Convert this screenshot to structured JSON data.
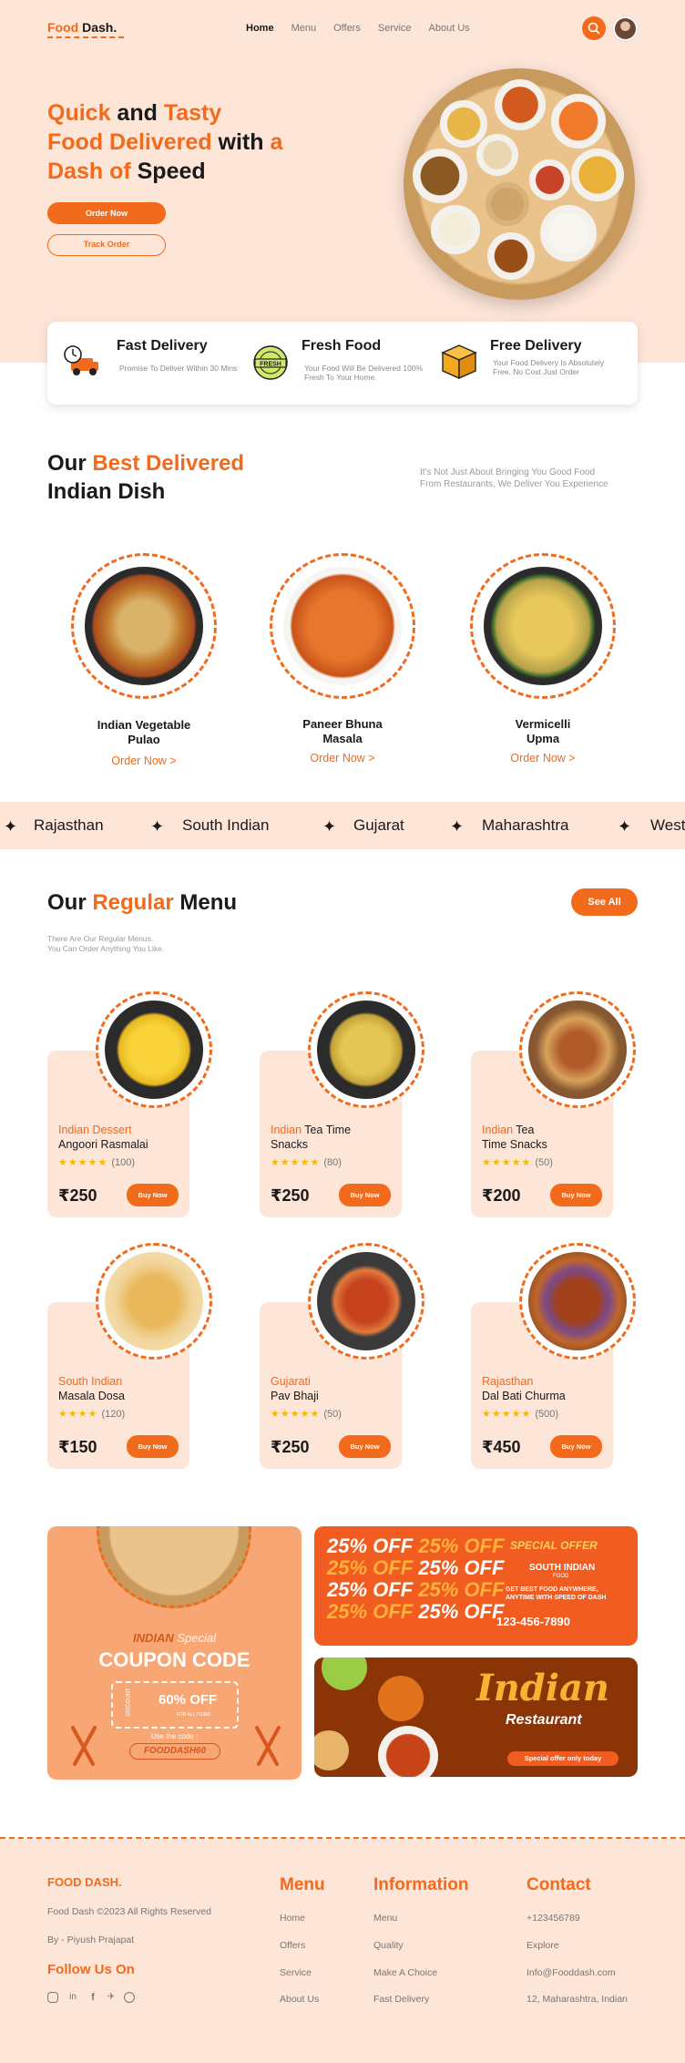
{
  "header": {
    "logo_part1": "Food",
    "logo_part2": "Dash.",
    "nav": [
      "Home",
      "Menu",
      "Offers",
      "Service",
      "About Us"
    ]
  },
  "hero": {
    "title_segments": [
      {
        "text": "Quick",
        "accent": true
      },
      {
        "text": " and ",
        "accent": false
      },
      {
        "text": "Tasty",
        "accent": true
      },
      {
        "text": "Food Delivered",
        "accent": true
      },
      {
        "text": " with ",
        "accent": false
      },
      {
        "text": "a",
        "accent": true
      },
      {
        "text": "Dash of",
        "accent": true
      },
      {
        "text": " Speed",
        "accent": false
      }
    ],
    "primary_button": "Order Now",
    "secondary_button": "Track Order"
  },
  "features": [
    {
      "title": "Fast Delivery",
      "subtitle": "Promise To Deliver Within 30 Mins",
      "icon": "delivery-truck-icon"
    },
    {
      "title": "Fresh Food",
      "subtitle": "Your Food Will Be Delivered 100% Fresh To Your Home.",
      "icon": "fresh-badge-icon",
      "badge": "FRESH"
    },
    {
      "title": "Free Delivery",
      "subtitle": "Your Food Delivery Is Absolutely Free. No Cost Just Order",
      "icon": "box-icon"
    }
  ],
  "best": {
    "title_our": "Our ",
    "title_accent": "Best Delivered",
    "title_line2": "Indian Dish",
    "subtitle_line1": "It's Not Just About Bringing You Good Food",
    "subtitle_line2": "From Restaurants, We Deliver You Experience",
    "dishes": [
      {
        "name_line1": "Indian Vegetable",
        "name_line2": "Pulao",
        "link": "Order Now >"
      },
      {
        "name_line1": "Paneer Bhuna",
        "name_line2": "Masala",
        "link": "Order Now >"
      },
      {
        "name_line1": "Vermicelli",
        "name_line2": "Upma",
        "link": "Order Now >"
      }
    ]
  },
  "regions": [
    "Rajasthan",
    "South Indian",
    "Gujarat",
    "Maharashtra",
    "West"
  ],
  "menu": {
    "title_our": "Our ",
    "title_accent": "Regular",
    "title_rest": " Menu",
    "see_all": "See All",
    "subtitle_line1": "There Are Our Regular Menus.",
    "subtitle_line2": "You Can Order Anything You Like.",
    "items": [
      {
        "cat_accent": "Indian Dessert",
        "cat_rest": "",
        "name": "Angoori Rasmalai",
        "rating": "(100)",
        "price": "₹250",
        "buy": "Buy Now",
        "stars": 5
      },
      {
        "cat_accent": "Indian",
        "cat_rest": " Tea Time",
        "name": "Snacks",
        "rating": "(80)",
        "price": "₹250",
        "buy": "Buy Now",
        "stars": 5
      },
      {
        "cat_accent": "Indian",
        "cat_rest": " Tea",
        "name": "Time Snacks",
        "rating": "(50)",
        "price": "₹200",
        "buy": "Buy Now",
        "stars": 5
      },
      {
        "cat_accent": "South Indian",
        "cat_rest": "",
        "name": "Masala Dosa",
        "rating": "(120)",
        "price": "₹150",
        "buy": "Buy Now",
        "stars": 4
      },
      {
        "cat_accent": "Gujarati",
        "cat_rest": "",
        "name": "Pav Bhaji",
        "rating": "(50)",
        "price": "₹250",
        "buy": "Buy Now",
        "stars": 5
      },
      {
        "cat_accent": "Rajasthan",
        "cat_rest": "",
        "name": "Dal Bati Churma",
        "rating": "(500)",
        "price": "₹450",
        "buy": "Buy Now",
        "stars": 5
      }
    ]
  },
  "promos": {
    "coupon": {
      "indian": "INDIAN",
      "special": "Special",
      "heading": "COUPON CODE",
      "ticket_side": "DISCOUNT",
      "discount": "60% OFF",
      "small": "FOR ALL ITEMS",
      "use_label": "Use the code :",
      "code": "FOODDASH60"
    },
    "offer": {
      "off_text": "25% OFF",
      "special": "SPECIAL OFFER",
      "brand": "SOUTH INDIAN",
      "brand_sub": "FOOD",
      "line1": "GET BEST FOOD ANYWHERE,",
      "line2": "ANYTIME WITH SPEED OF DASH",
      "phone": "123-456-7890"
    },
    "restaurant": {
      "title": "Indian",
      "subtitle": "Restaurant",
      "pill": "Special offer only today"
    }
  },
  "footer": {
    "logo": "FOOD DASH.",
    "copyright": "Food Dash ©2023 All Rights Reserved",
    "by": "By - Piyush Prajapat",
    "follow": "Follow Us On",
    "social_icons": [
      "instagram-icon",
      "linkedin-icon",
      "facebook-icon",
      "twitter-icon",
      "dribbble-icon"
    ],
    "menu_title": "Menu",
    "menu_links": [
      "Home",
      "Offers",
      "Service",
      "About Us"
    ],
    "info_title": "Information",
    "info_links": [
      "Menu",
      "Quality",
      "Make A Choice",
      "Fast Delivery"
    ],
    "contact_title": "Contact",
    "contact_lines": [
      "+123456789",
      "Explore",
      "Info@Fooddash.com",
      "12, Maharashtra, Indian"
    ]
  },
  "colors": {
    "accent": "#f26a1b",
    "peach": "#fde5d8",
    "star": "#f6b900"
  }
}
